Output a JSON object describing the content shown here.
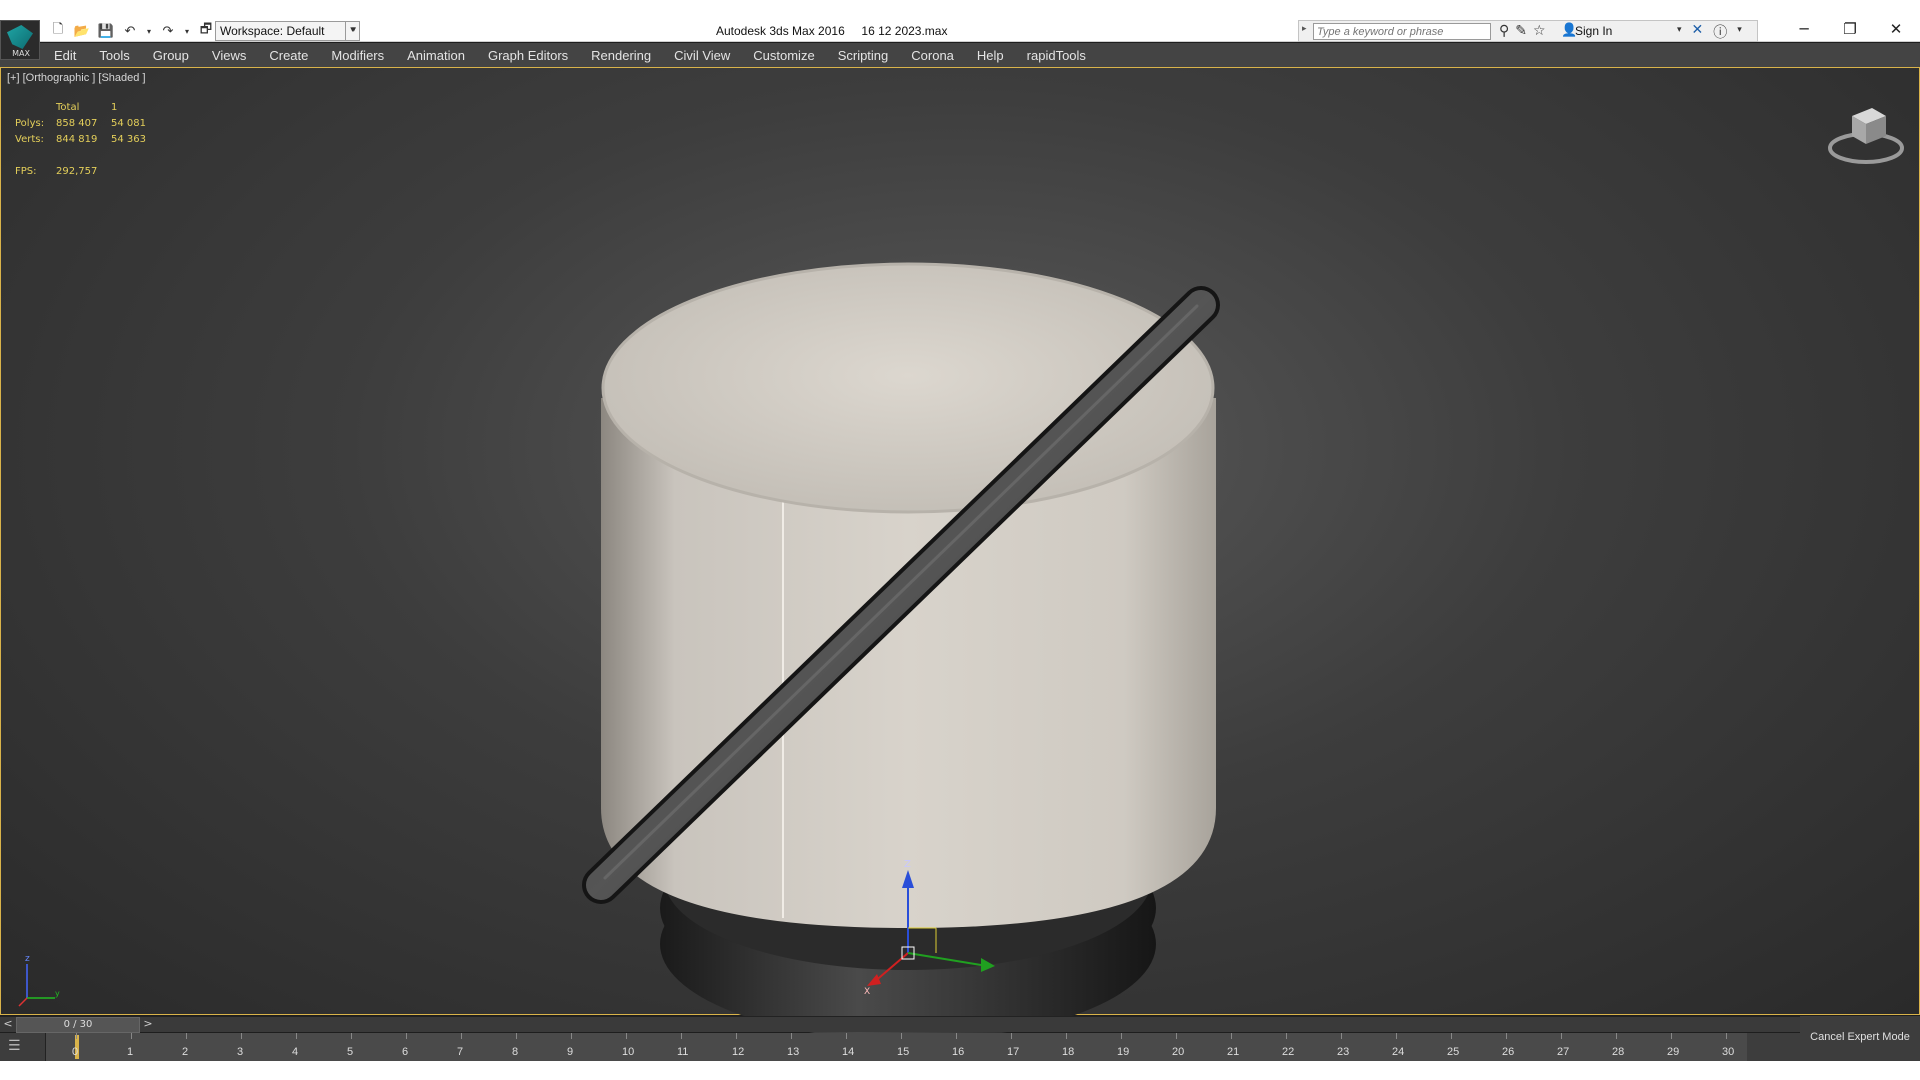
{
  "app": {
    "logo_text": "MAX",
    "title": "Autodesk 3ds Max 2016     16 12 2023.max"
  },
  "workspace": {
    "label": "Workspace: Default"
  },
  "search": {
    "placeholder": "Type a keyword or phrase",
    "signin": "Sign In"
  },
  "menu": [
    "Edit",
    "Tools",
    "Group",
    "Views",
    "Create",
    "Modifiers",
    "Animation",
    "Graph Editors",
    "Rendering",
    "Civil View",
    "Customize",
    "Scripting",
    "Corona",
    "Help",
    "rapidTools"
  ],
  "viewport": {
    "label": "[+] [Orthographic ] [Shaded ]",
    "stats": {
      "header": [
        "",
        "Total",
        "1"
      ],
      "polys": [
        "Polys:",
        "858 407",
        "54 081"
      ],
      "verts": [
        "Verts:",
        "844 819",
        "54 363"
      ],
      "fps": [
        "FPS:",
        "292,757"
      ]
    },
    "accent": "#d9b34a"
  },
  "timeslider": {
    "position": "0 / 30",
    "prev": "<",
    "next": ">"
  },
  "trackbar": {
    "ticks": [
      "0",
      "1",
      "2",
      "3",
      "4",
      "5",
      "6",
      "7",
      "8",
      "9",
      "10",
      "11",
      "12",
      "13",
      "14",
      "15",
      "16",
      "17",
      "18",
      "19",
      "20",
      "21",
      "22",
      "23",
      "24",
      "25",
      "26",
      "27",
      "28",
      "29",
      "30"
    ]
  },
  "expert": {
    "label": "Cancel Expert Mode"
  },
  "icons": {
    "new": "new-file-icon",
    "open": "open-file-icon",
    "save": "save-icon",
    "undo": "undo-icon",
    "redo": "redo-icon",
    "project": "project-folder-icon"
  }
}
